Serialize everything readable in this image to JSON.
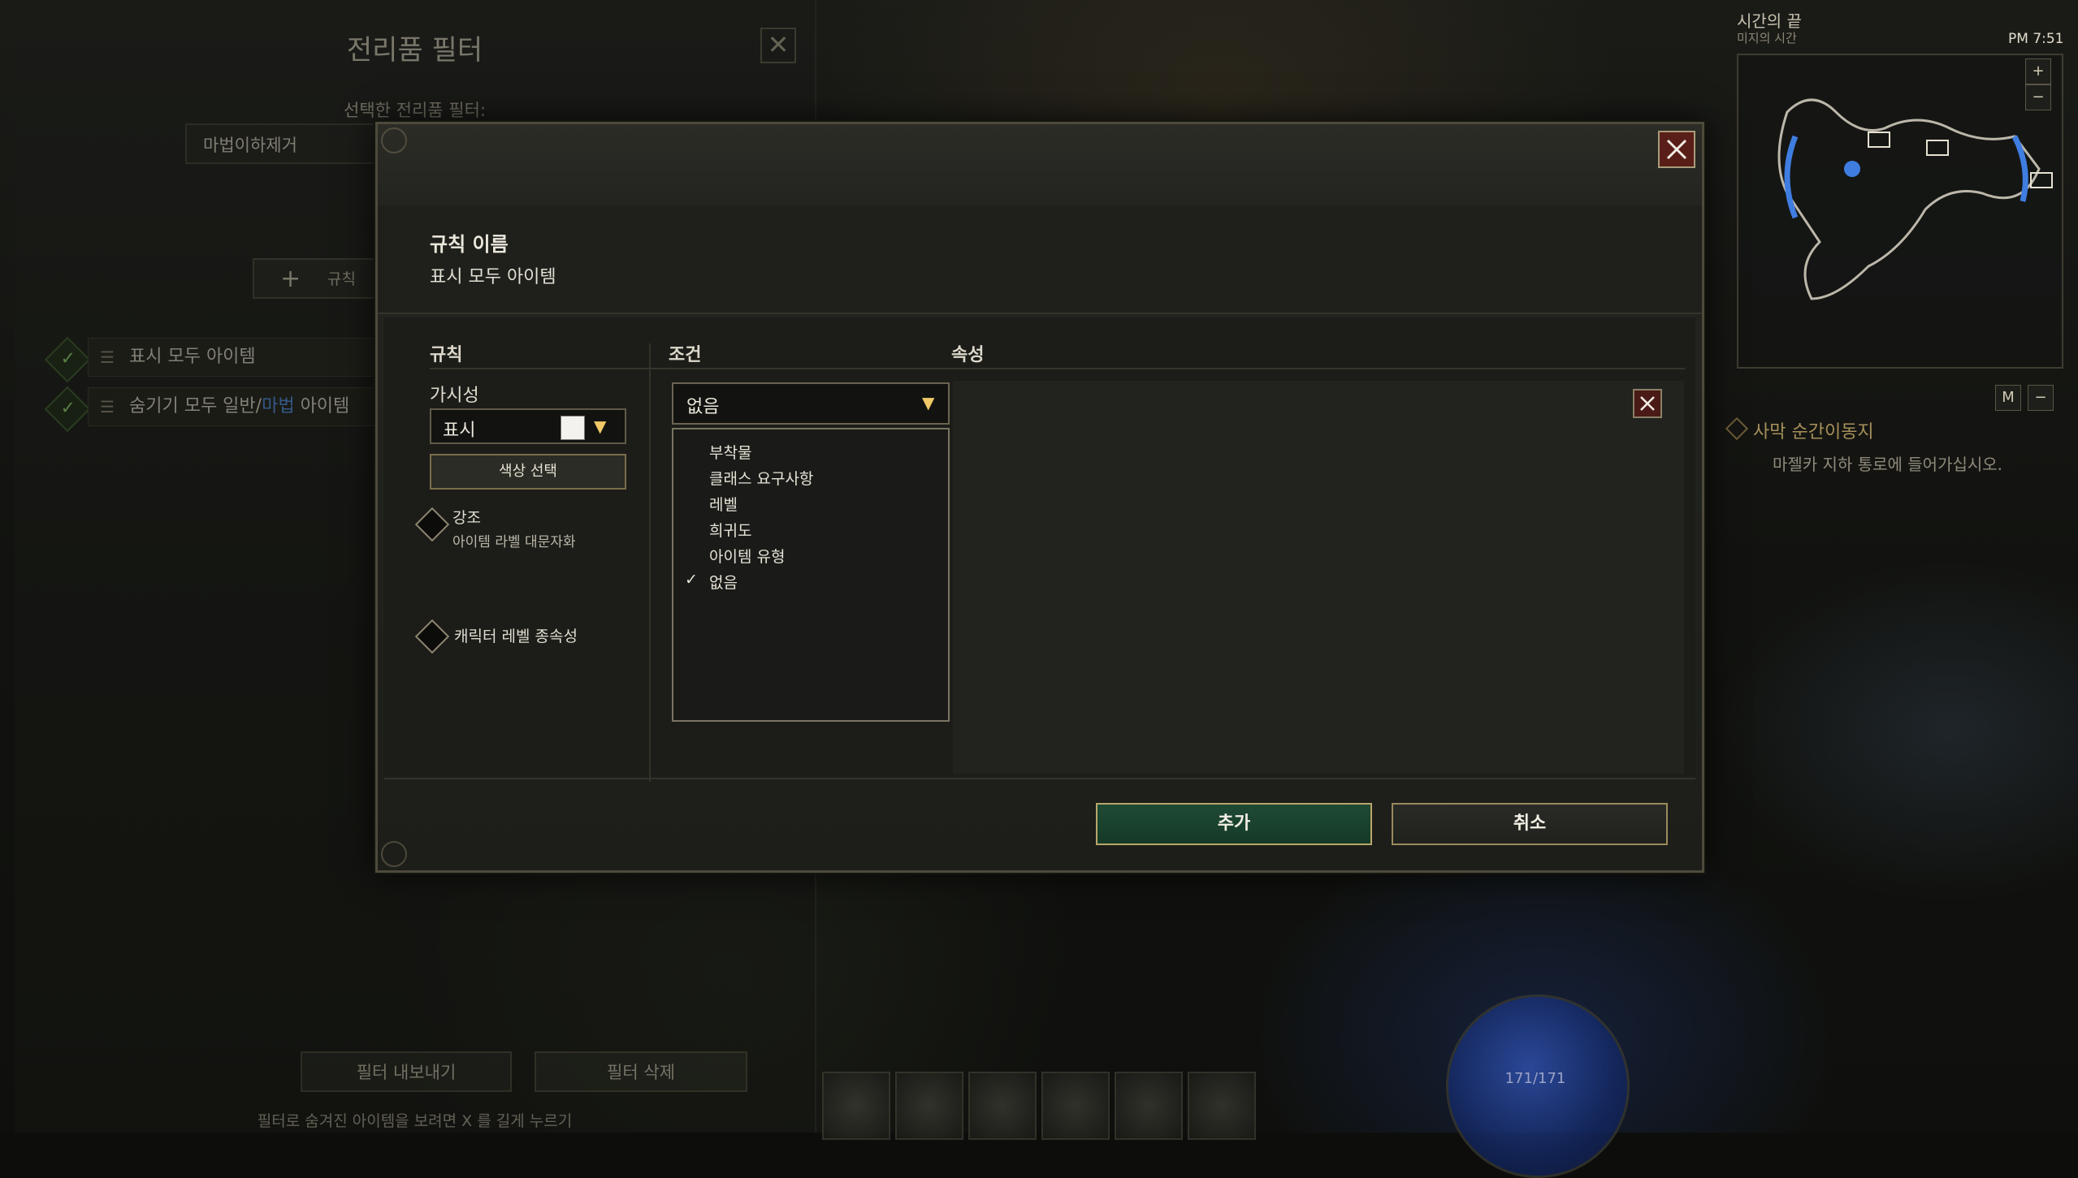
{
  "background_panel": {
    "title": "전리품 필터",
    "selected_filter_label": "선택한 전리품 필터:",
    "selected_filter_value": "마법이하제거",
    "add_rule_label": "규칙",
    "rules": [
      {
        "label_prefix": "표시 모두 아이템",
        "label_highlight": "",
        "label_suffix": ""
      },
      {
        "label_prefix": "숨기기 모두 일반/",
        "label_highlight": "마법",
        "label_suffix": " 아이템"
      }
    ],
    "export_button": "필터 내보내기",
    "delete_button": "필터 삭제",
    "hint": "필터로 숨겨진 아이템을 보려면 X 를 길게 누르기"
  },
  "minimap": {
    "zone_title": "시간의 끝",
    "zone_subtitle": "미지의 시간",
    "time": "PM 7:51",
    "map_key": "M",
    "zoom_in": "+",
    "zoom_out": "−",
    "minus_btn": "−"
  },
  "quest": {
    "title": "사막 순간이동지",
    "objective": "마젤카 지하 통로에 들어가십시오."
  },
  "hud": {
    "health_text": "171/171"
  },
  "dialog": {
    "rule_name_label": "규칙 이름",
    "rule_name_value": "표시 모두 아이템",
    "columns": {
      "rule": "규칙",
      "condition": "조건",
      "attribute": "속성"
    },
    "visibility_label": "가시성",
    "visibility_value": "표시",
    "swatch_color": "#f4f2ee",
    "color_select_button": "색상 선택",
    "emphasis_title": "강조",
    "emphasis_sub": "아이템 라벨 대문자화",
    "char_level_dependency": "캐릭터 레벨 종속성",
    "condition_selected": "없음",
    "condition_options": [
      {
        "label": "부착물",
        "checked": false
      },
      {
        "label": "클래스 요구사항",
        "checked": false
      },
      {
        "label": "레벨",
        "checked": false
      },
      {
        "label": "희귀도",
        "checked": false
      },
      {
        "label": "아이템 유형",
        "checked": false
      },
      {
        "label": "없음",
        "checked": true
      }
    ],
    "add_button": "추가",
    "cancel_button": "취소"
  },
  "colors": {
    "accent_gold": "#f0c868",
    "confirm_green": "#1f4a34",
    "close_red": "#5a1e18",
    "magic_blue": "#4f8fe8"
  }
}
